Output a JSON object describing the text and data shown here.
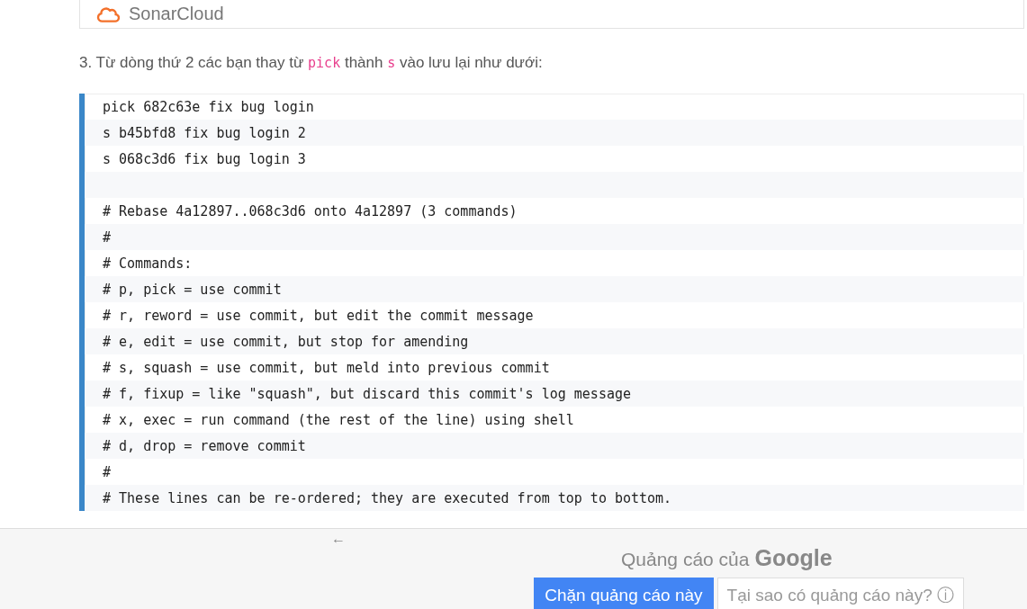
{
  "brand_card": {
    "name": "SonarCloud"
  },
  "instruction_parts": [
    {
      "kind": "text",
      "text": "3. Từ dòng thứ 2 các bạn thay từ"
    },
    {
      "kind": "code",
      "text": "pick"
    },
    {
      "kind": "text",
      "text": "thành"
    },
    {
      "kind": "code",
      "text": "s"
    },
    {
      "kind": "text",
      "text": "vào lưu lại như dưới:"
    }
  ],
  "code_lines": [
    {
      "kind": "code",
      "text": "pick 682c63e fix bug login"
    },
    {
      "kind": "code",
      "text": "s b45bfd8 fix bug login 2"
    },
    {
      "kind": "code",
      "text": "s 068c3d6 fix bug login 3"
    },
    {
      "kind": "blank"
    },
    {
      "kind": "code",
      "text": "# Rebase 4a12897..068c3d6 onto 4a12897 (3 commands)"
    },
    {
      "kind": "code",
      "text": "#"
    },
    {
      "kind": "code",
      "text": "# Commands:"
    },
    {
      "kind": "code",
      "text": "# p, pick = use commit"
    },
    {
      "kind": "code",
      "text": "# r, reword = use commit, but edit the commit message"
    },
    {
      "kind": "code",
      "text": "# e, edit = use commit, but stop for amending"
    },
    {
      "kind": "code",
      "text": "# s, squash = use commit, but meld into previous commit"
    },
    {
      "kind": "code",
      "text": "# f, fixup = like \"squash\", but discard this commit's log message"
    },
    {
      "kind": "code",
      "text": "# x, exec = run command (the rest of the line) using shell"
    },
    {
      "kind": "code",
      "text": "# d, drop = remove commit"
    },
    {
      "kind": "code",
      "text": "#"
    },
    {
      "kind": "code",
      "text": "# These lines can be re-ordered; they are executed from top to bottom."
    }
  ],
  "ad_bar": {
    "back": "←",
    "label": "Quảng cáo của",
    "brand": "Google",
    "block_button": "Chặn quảng cáo này",
    "why_button": "Tại sao có quảng cáo này?",
    "info": "ⓘ"
  }
}
